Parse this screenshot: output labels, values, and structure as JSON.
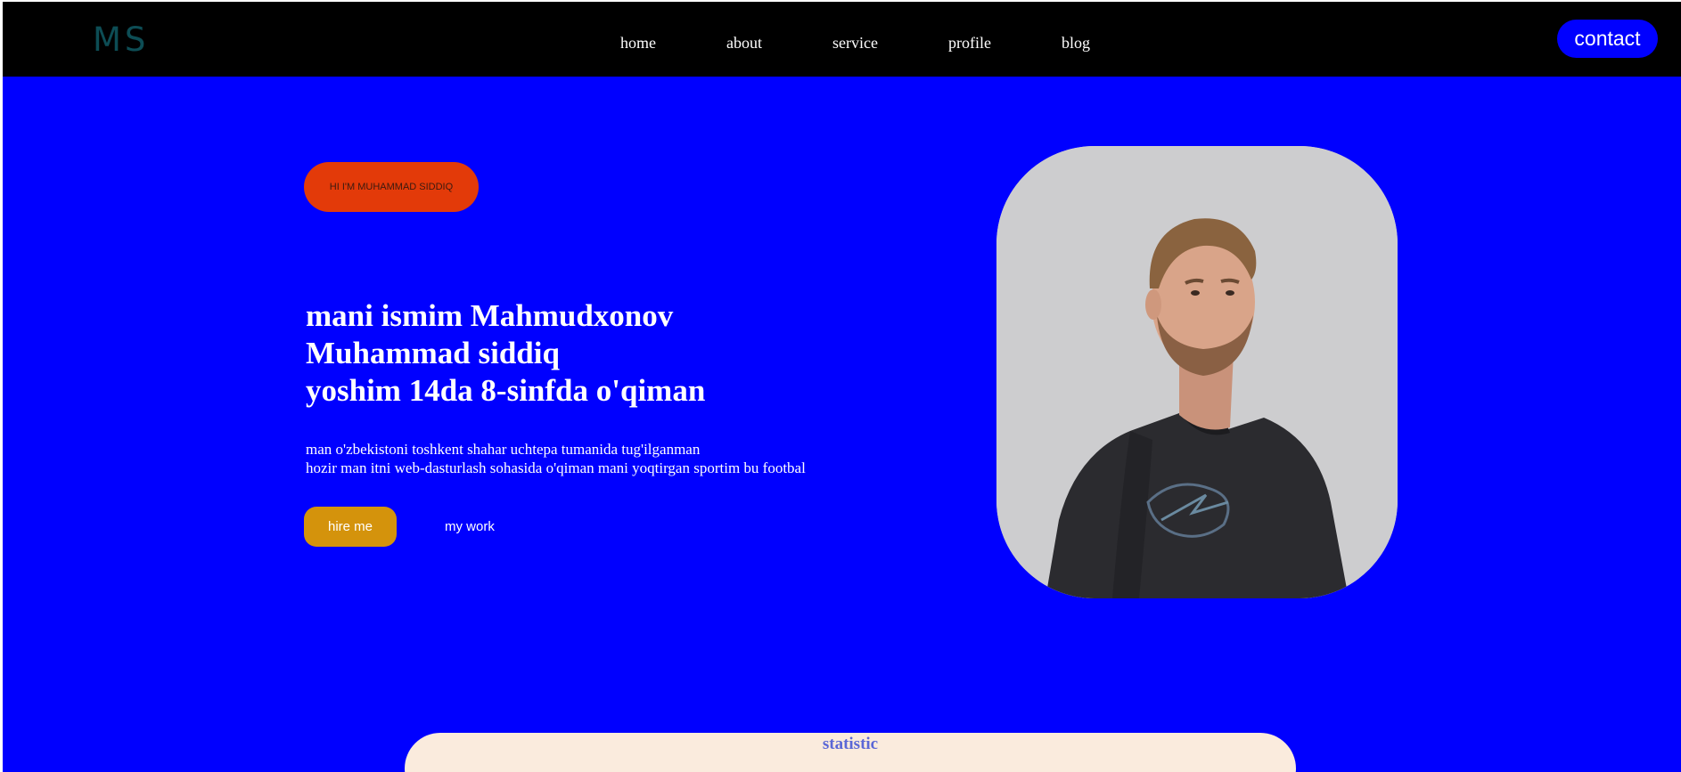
{
  "navbar": {
    "logo": "MS",
    "links": [
      "home",
      "about",
      "service",
      "profile",
      "blog"
    ],
    "contact_label": "contact"
  },
  "hero": {
    "intro_pill": "HI I'M MUHAMMAD SIDDIQ",
    "headline": [
      "mani ismim Mahmudxonov",
      "Muhammad siddiq",
      "yoshim 14da 8-sinfda o'qiman"
    ],
    "description": [
      "man o'zbekistoni toshkent shahar uchtepa tumanida tug'ilganman",
      "hozir man itni web-dasturlash sohasida o'qiman mani yoqtirgan sportim bu footbal"
    ],
    "hire_label": "hire me",
    "work_label": "my work",
    "portrait_alt": "portrait photo"
  },
  "statistic": {
    "title": "statistic"
  },
  "colors": {
    "background": "#0000ff",
    "navbar": "#000000",
    "pill": "#e33a09",
    "hire_button": "#d4930c",
    "card": "#faebdd"
  }
}
